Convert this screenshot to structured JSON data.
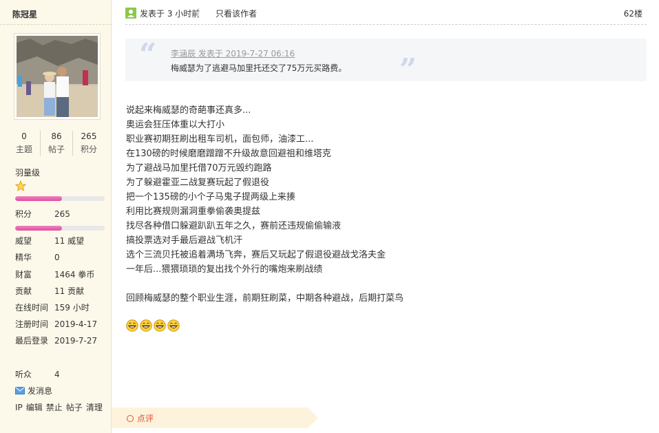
{
  "user": {
    "name": "陈冠星",
    "stats": [
      {
        "value": "0",
        "label": "主题"
      },
      {
        "value": "86",
        "label": "帖子"
      },
      {
        "value": "265",
        "label": "积分"
      }
    ],
    "level": "羽量级",
    "level_progress": 0.52,
    "points_label": "积分",
    "points_value": "265",
    "points_progress": 0.52,
    "info": [
      {
        "label": "威望",
        "value": "11 威望"
      },
      {
        "label": "精华",
        "value": "0"
      },
      {
        "label": "财富",
        "value": "1464 拳币"
      },
      {
        "label": "贡献",
        "value": "11 贡献"
      },
      {
        "label": "在线时间",
        "value": "159 小时"
      },
      {
        "label": "注册时间",
        "value": "2019-4-17"
      },
      {
        "label": "最后登录",
        "value": "2019-7-27"
      }
    ],
    "listeners_label": "听众",
    "listeners_value": "4",
    "send_message": "发消息",
    "admin_links": [
      "IP",
      "编辑",
      "禁止",
      "帖子",
      "清理"
    ]
  },
  "post": {
    "time": "发表于 3 小时前",
    "only_author": "只看该作者",
    "floor": "62楼",
    "quote_meta": "李涵辰 发表于 2019-7-27 06:16",
    "quote_text": "梅威瑟为了逃避马加里托还交了75万元买路费。",
    "body_lines": [
      "说起来梅威瑟的奇葩事还真多...",
      "奥运会狂压体重以大打小",
      "职业赛初期狂刷出租车司机，面包师，油漆工...",
      "在130磅的时候磨磨蹭蹭不升级故意回避祖和维塔克",
      "为了避战马加里托借70万元毁约跑路",
      "为了躲避霍亚二战复赛玩起了假退役",
      "把一个135磅的小个子马鬼子提两级上来揍",
      "利用比赛规则漏洞重拳偷袭奥提兹",
      "找尽各种借口躲避趴趴五年之久，赛前还违规偷偷输液",
      "搞投票选对手最后避战飞机汗",
      "选个三流贝托被追着满场飞奔，赛后又玩起了假退役避战戈洛夫金",
      "一年后...猥猥琐琐的复出找个外行的嘴炮来刷战绩",
      "",
      "回顾梅威瑟的整个职业生涯，前期狂刷菜，中期各种避战，后期打菜鸟"
    ],
    "emoji_count": 4,
    "comment_label": "点评"
  },
  "colors": {
    "sidebar_bg": "#fdf9ea",
    "progress": "#e0509e",
    "comment": "#e0502c"
  }
}
